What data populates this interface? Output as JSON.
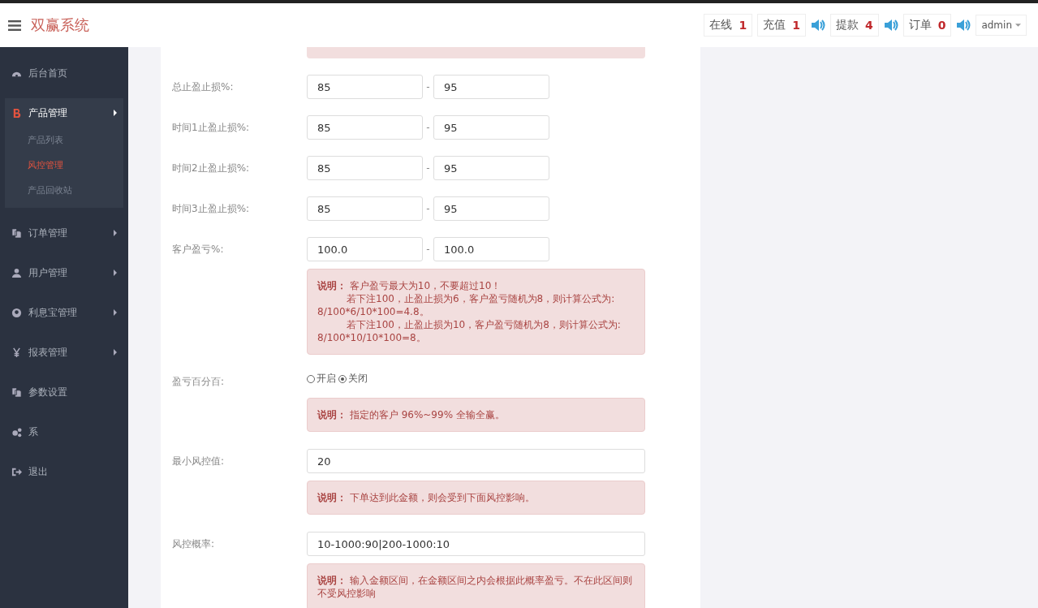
{
  "header": {
    "title": "双赢系统",
    "badges": [
      {
        "label": "在线",
        "count": "1",
        "kind": "plain"
      },
      {
        "label": "充值",
        "count": "1",
        "kind": "sound"
      },
      {
        "label": "提款",
        "count": "4",
        "kind": "sound"
      },
      {
        "label": "订单",
        "count": "0",
        "kind": "sound"
      }
    ],
    "user": "admin"
  },
  "sidebar": {
    "items": [
      {
        "label": "后台首页",
        "kind": "dashboard",
        "collapsible": false,
        "expanded": false
      },
      {
        "label": "产品管理",
        "kind": "bitcoin",
        "collapsible": true,
        "expanded": true,
        "children": [
          {
            "label": "产品列表",
            "selected": false
          },
          {
            "label": "风控管理",
            "selected": true
          },
          {
            "label": "产品回收站",
            "selected": false
          }
        ]
      },
      {
        "label": "订单管理",
        "kind": "copy",
        "collapsible": true,
        "expanded": false
      },
      {
        "label": "用户管理",
        "kind": "user",
        "collapsible": true,
        "expanded": false
      },
      {
        "label": "利息宝管理",
        "kind": "pin",
        "collapsible": true,
        "expanded": false
      },
      {
        "label": "报表管理",
        "kind": "yen",
        "collapsible": true,
        "expanded": false
      },
      {
        "label": "参数设置",
        "kind": "copy",
        "collapsible": false,
        "expanded": false
      },
      {
        "label": "系",
        "kind": "cogs",
        "collapsible": false,
        "expanded": false
      },
      {
        "label": "退出",
        "kind": "logout",
        "collapsible": false,
        "expanded": false
      }
    ]
  },
  "form": {
    "rows": [
      {
        "kind": "range",
        "label": "总止盈止损%:",
        "from": "85",
        "separator": "-",
        "to": "95"
      },
      {
        "kind": "range",
        "label": "时间1止盈止损%:",
        "from": "85",
        "separator": "-",
        "to": "95"
      },
      {
        "kind": "range",
        "label": "时间2止盈止损%:",
        "from": "85",
        "separator": "-",
        "to": "95"
      },
      {
        "kind": "range",
        "label": "时间3止盈止损%:",
        "from": "85",
        "separator": "-",
        "to": "95"
      },
      {
        "kind": "range",
        "label": "客户盈亏%:",
        "from": "100.0",
        "separator": "-",
        "to": "100.0"
      },
      {
        "kind": "note",
        "lines": [
          {
            "text": "**说明：** 客户盈亏最大为10，不要超过10！",
            "indent": false
          },
          {
            "text": "若下注100，止盈止损为6，客户盈亏随机为8，则计算公式为: 8/100*6/10*100=4.8。",
            "indent": true
          },
          {
            "text": "若下注100，止盈止损为10，客户盈亏随机为8，则计算公式为: 8/100*10/10*100=8。",
            "indent": true
          }
        ]
      },
      {
        "kind": "radio",
        "label": "盈亏百分百:",
        "options": [
          {
            "label": "开启",
            "selected": false
          },
          {
            "label": "关闭",
            "selected": true
          }
        ]
      },
      {
        "kind": "note",
        "lines": [
          {
            "text": "**说明：** 指定的客户 96%~99% 全输全赢。",
            "indent": false
          }
        ]
      },
      {
        "kind": "text",
        "label": "最小风控值:",
        "value": "20"
      },
      {
        "kind": "note",
        "lines": [
          {
            "text": "**说明：** 下单达到此金额，则会受到下面风控影响。",
            "indent": false
          }
        ]
      },
      {
        "kind": "text",
        "label": "风控概率:",
        "value": "10-1000:90|200-1000:10"
      },
      {
        "kind": "note",
        "lines": [
          {
            "text": "**说明：** 输入金额区间，在金额区间之内会根据此概率盈亏。不在此区间则不受风控影响",
            "indent": false
          }
        ]
      }
    ]
  }
}
